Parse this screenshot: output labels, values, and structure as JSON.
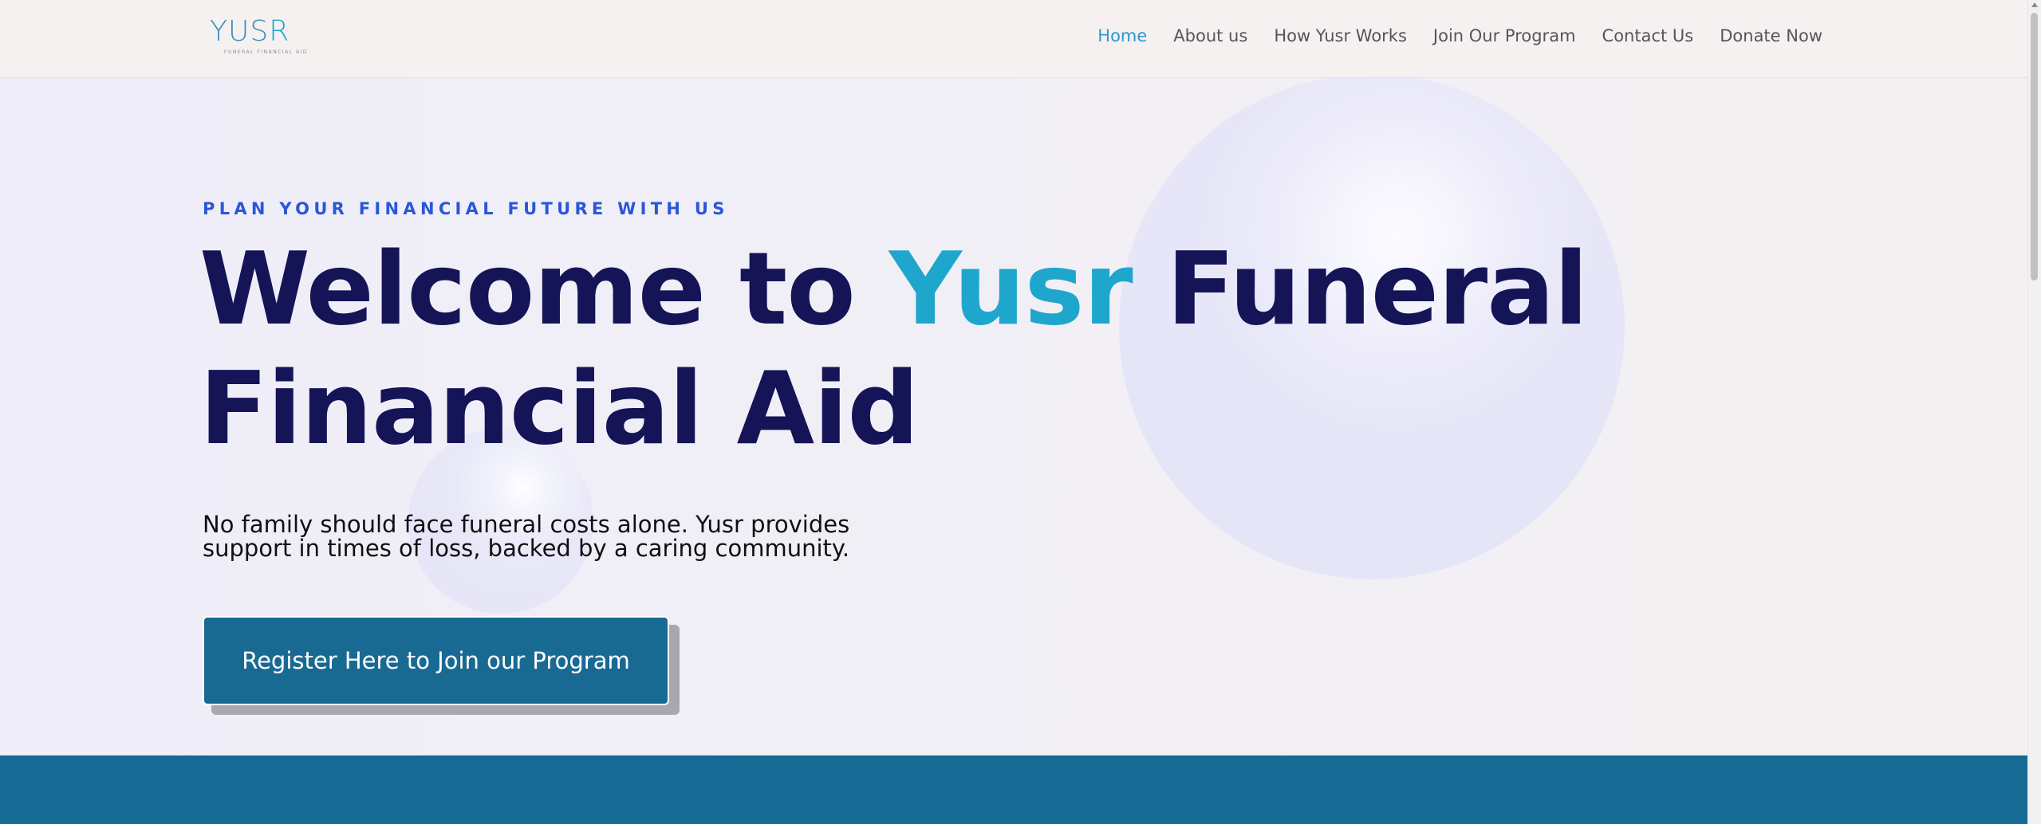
{
  "header": {
    "logo": {
      "word_main": "YUS",
      "word_accent": "R",
      "tagline": "FUNERAL FINANCIAL AID"
    },
    "nav": [
      {
        "label": "Home",
        "active": true
      },
      {
        "label": "About us",
        "active": false
      },
      {
        "label": "How Yusr Works",
        "active": false
      },
      {
        "label": "Join Our Program",
        "active": false
      },
      {
        "label": "Contact Us",
        "active": false
      },
      {
        "label": "Donate Now",
        "active": false
      }
    ]
  },
  "hero": {
    "eyebrow": "PLAN YOUR FINANCIAL FUTURE WITH US",
    "headline": {
      "before": "Welcome to ",
      "accent": "Yusr",
      "after_line1": " Funeral",
      "line2": "Financial Aid"
    },
    "subtext": "No family should face funeral costs alone. Yusr provides support in times of loss, backed by a caring community.",
    "cta_label": "Register Here to Join our Program"
  },
  "colors": {
    "brand_navy": "#141457",
    "brand_teal": "#1fa6cd",
    "eyebrow_blue": "#2b56d8",
    "cta_bg": "#196a93",
    "band_bg": "#166b94",
    "nav_active": "#2c98d1"
  }
}
